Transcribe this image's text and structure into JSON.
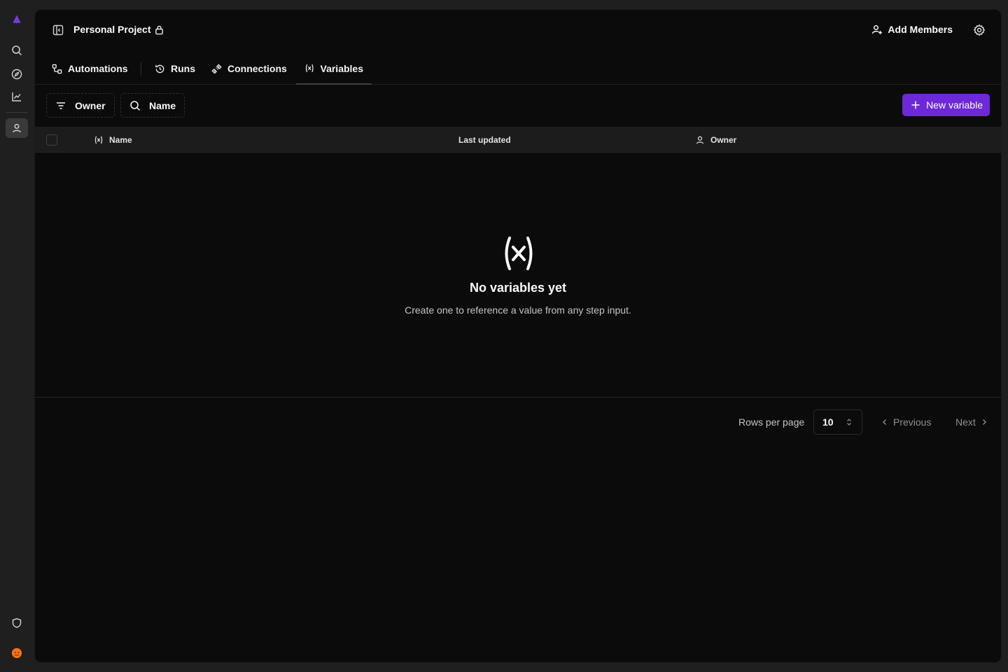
{
  "rail": {
    "items": [
      {
        "name": "logo-icon"
      },
      {
        "name": "search-icon"
      },
      {
        "name": "compass-icon"
      },
      {
        "name": "chart-icon"
      },
      {
        "name": "user-icon"
      },
      {
        "name": "shield-icon"
      },
      {
        "name": "avatar"
      }
    ],
    "brand_color": "#7c3aed",
    "avatar_color": "#f97316"
  },
  "header": {
    "project_title": "Personal Project",
    "add_members_label": "Add Members"
  },
  "tabs": [
    {
      "label": "Automations",
      "icon": "workflow-icon"
    },
    {
      "label": "Runs",
      "icon": "history-icon"
    },
    {
      "label": "Connections",
      "icon": "plug-icon"
    },
    {
      "label": "Variables",
      "icon": "variable-icon",
      "active": true
    }
  ],
  "toolbar": {
    "owner_filter_label": "Owner",
    "name_filter_label": "Name",
    "new_button_label": "New variable",
    "accent": "#6d28d9"
  },
  "table": {
    "columns": [
      "Name",
      "Last updated",
      "Owner"
    ]
  },
  "empty_state": {
    "title": "No variables yet",
    "subtitle": "Create one to reference a value from any step input."
  },
  "pagination": {
    "rows_per_page_label": "Rows per page",
    "rows_per_page_value": "10",
    "previous_label": "Previous",
    "next_label": "Next"
  }
}
